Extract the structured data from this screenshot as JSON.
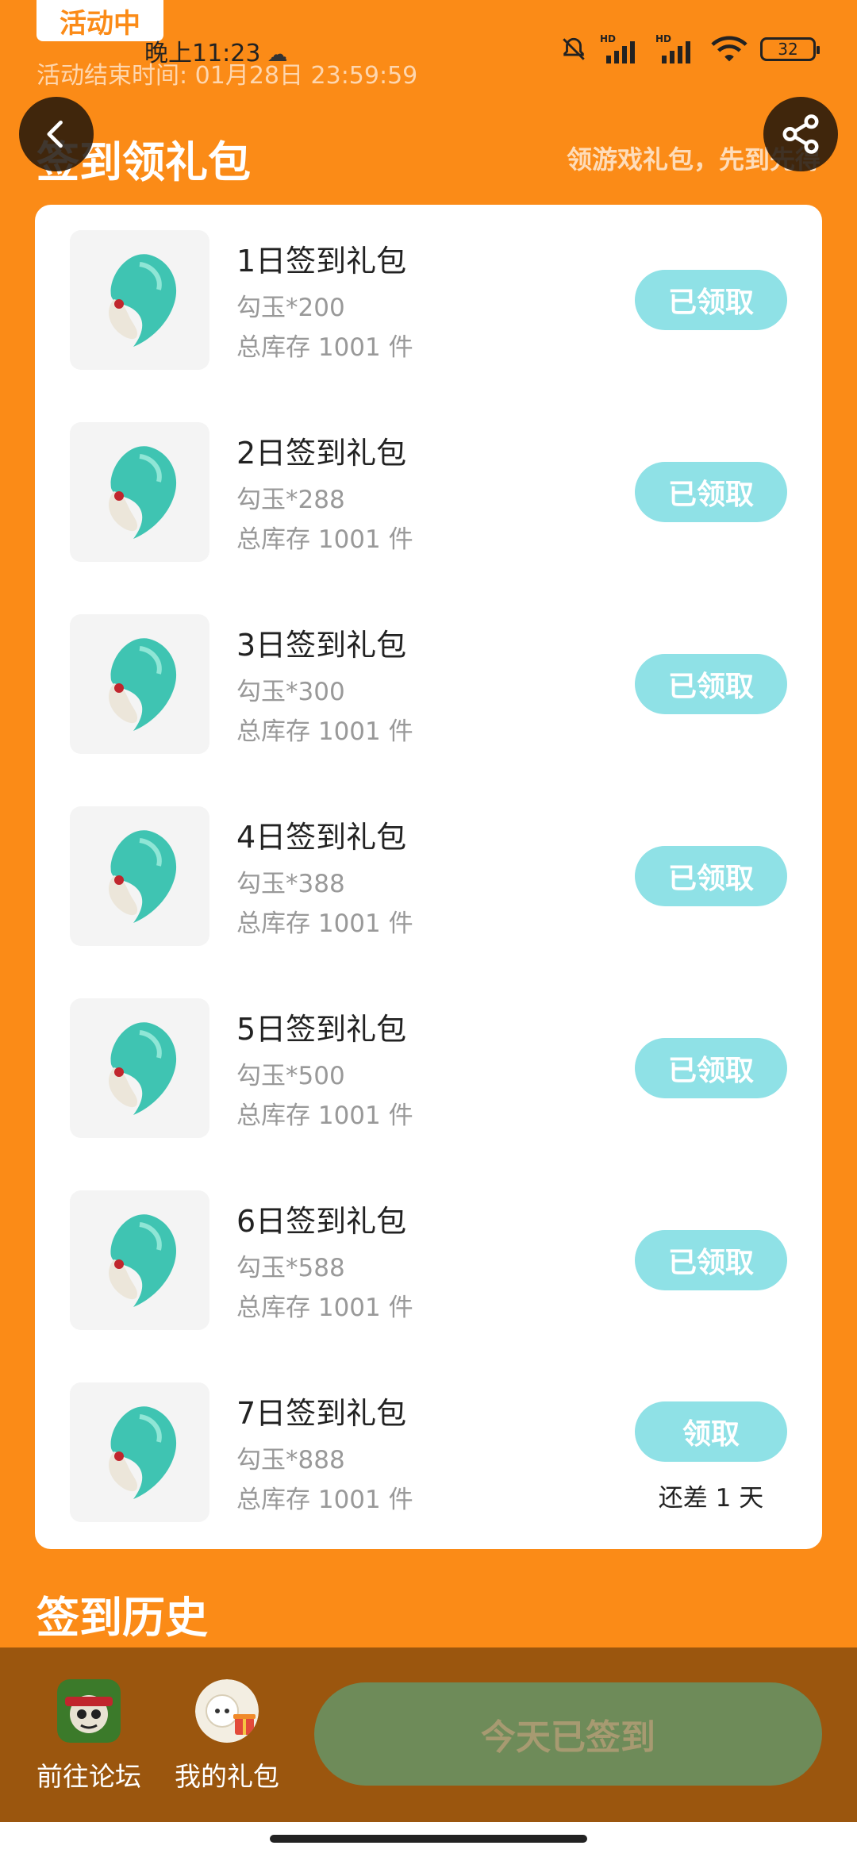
{
  "status_bar": {
    "badge": "活动中",
    "time": "晚上11:23",
    "battery": "32",
    "hd1": "HD",
    "hd2": "HD"
  },
  "header": {
    "end_time": "活动结束时间: 01月28日 23:59:59",
    "title": "签到领礼包",
    "slogan": "领游戏礼包，先到先得"
  },
  "gifts": [
    {
      "name": "1日签到礼包",
      "qty": "勾玉*200",
      "stock": "总库存 1001 件",
      "button": "已领取"
    },
    {
      "name": "2日签到礼包",
      "qty": "勾玉*288",
      "stock": "总库存 1001 件",
      "button": "已领取"
    },
    {
      "name": "3日签到礼包",
      "qty": "勾玉*300",
      "stock": "总库存 1001 件",
      "button": "已领取"
    },
    {
      "name": "4日签到礼包",
      "qty": "勾玉*388",
      "stock": "总库存 1001 件",
      "button": "已领取"
    },
    {
      "name": "5日签到礼包",
      "qty": "勾玉*500",
      "stock": "总库存 1001 件",
      "button": "已领取"
    },
    {
      "name": "6日签到礼包",
      "qty": "勾玉*588",
      "stock": "总库存 1001 件",
      "button": "已领取"
    },
    {
      "name": "7日签到礼包",
      "qty": "勾玉*888",
      "stock": "总库存 1001 件",
      "button": "领取",
      "note": "还差 1 天"
    }
  ],
  "history": {
    "title": "签到历史"
  },
  "bottom_bar": {
    "forum_label": "前往论坛",
    "mygifts_label": "我的礼包",
    "signed_label": "今天已签到"
  },
  "colors": {
    "background": "#FB8B17",
    "button_claimed": "#8FE1E6",
    "bottom_bar": "#9B560E",
    "signed_button": "#6E8B59"
  }
}
